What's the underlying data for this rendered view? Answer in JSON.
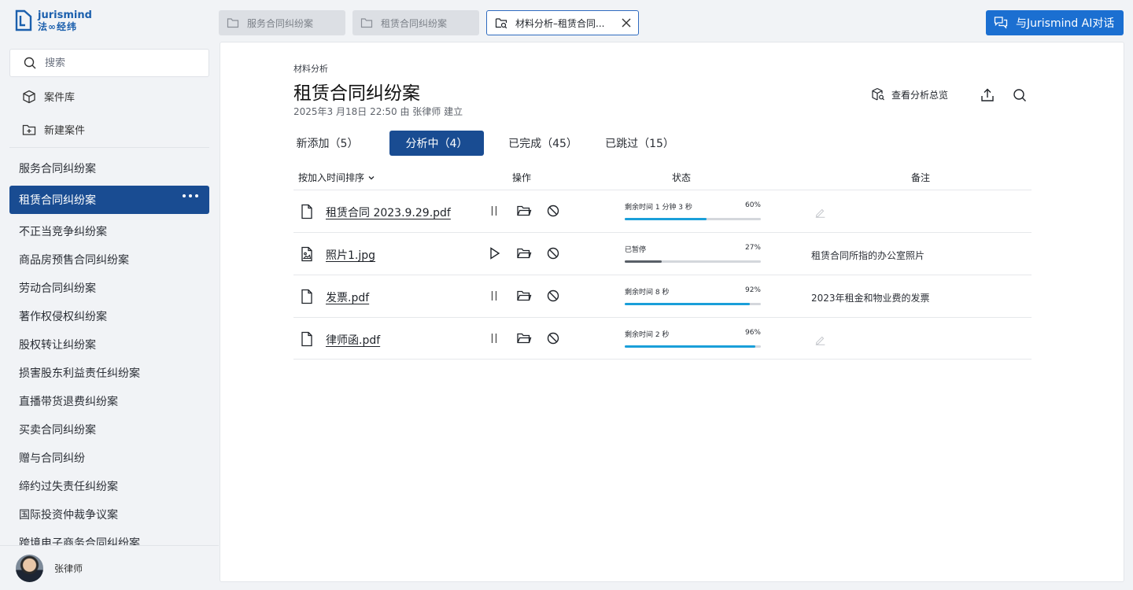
{
  "brand": {
    "name_en": "jurismind",
    "name_cn": "法∞经纬"
  },
  "sidebar": {
    "search_placeholder": "搜索",
    "library_label": "案件库",
    "new_case_label": "新建案件",
    "cases": [
      "服务合同纠纷案",
      "租赁合同纠纷案",
      "不正当竞争纠纷案",
      "商品房预售合同纠纷案",
      "劳动合同纠纷案",
      "著作权侵权纠纷案",
      "股权转让纠纷案",
      "损害股东利益责任纠纷案",
      "直播带货退费纠纷案",
      "买卖合同纠纷案",
      "赠与合同纠纷",
      "缔约过失责任纠纷案",
      "国际投资仲裁争议案",
      "跨境电子商务合同纠纷案"
    ],
    "active_case_index": 1,
    "user_name": "张律师"
  },
  "tabs": [
    {
      "label": "服务合同纠纷案",
      "active": false
    },
    {
      "label": "租赁合同纠纷案",
      "active": false
    },
    {
      "label": "材料分析–租赁合同...",
      "active": true
    }
  ],
  "chat_button": "与Jurismind AI对话",
  "page": {
    "kicker": "材料分析",
    "title": "租赁合同纠纷案",
    "meta": "2025年3 月18日 22:50  由 张律师 建立",
    "overview_label": "查看分析总览"
  },
  "filters": [
    "新添加（5）",
    "分析中（4）",
    "已完成（45）",
    "已跳过（15）"
  ],
  "active_filter_index": 1,
  "table": {
    "headers": {
      "sort": "按加入时间排序",
      "actions": "操作",
      "status": "状态",
      "notes": "备注"
    },
    "rows": [
      {
        "name": "租赁合同 2023.9.29.pdf",
        "type": "file",
        "state": "running",
        "status_text": "剩余时间 1 分钟 3 秒",
        "percent_label": "60%",
        "progress": 0.6,
        "note": ""
      },
      {
        "name": "照片1.jpg",
        "type": "image",
        "state": "paused",
        "status_text": "已暂停",
        "percent_label": "27%",
        "progress": 0.27,
        "note": "租赁合同所指的办公室照片"
      },
      {
        "name": "发票.pdf",
        "type": "file",
        "state": "running",
        "status_text": "剩余时间 8 秒",
        "percent_label": "92%",
        "progress": 0.92,
        "note": "2023年租金和物业费的发票"
      },
      {
        "name": "律师函.pdf",
        "type": "file",
        "state": "running",
        "status_text": "剩余时间 2 秒",
        "percent_label": "96%",
        "progress": 0.96,
        "note": ""
      }
    ]
  },
  "colors": {
    "accent": "#194c92",
    "chat_button": "#1b6fd1",
    "progress": "#1a9fd9",
    "paused_progress": "#595f67"
  }
}
